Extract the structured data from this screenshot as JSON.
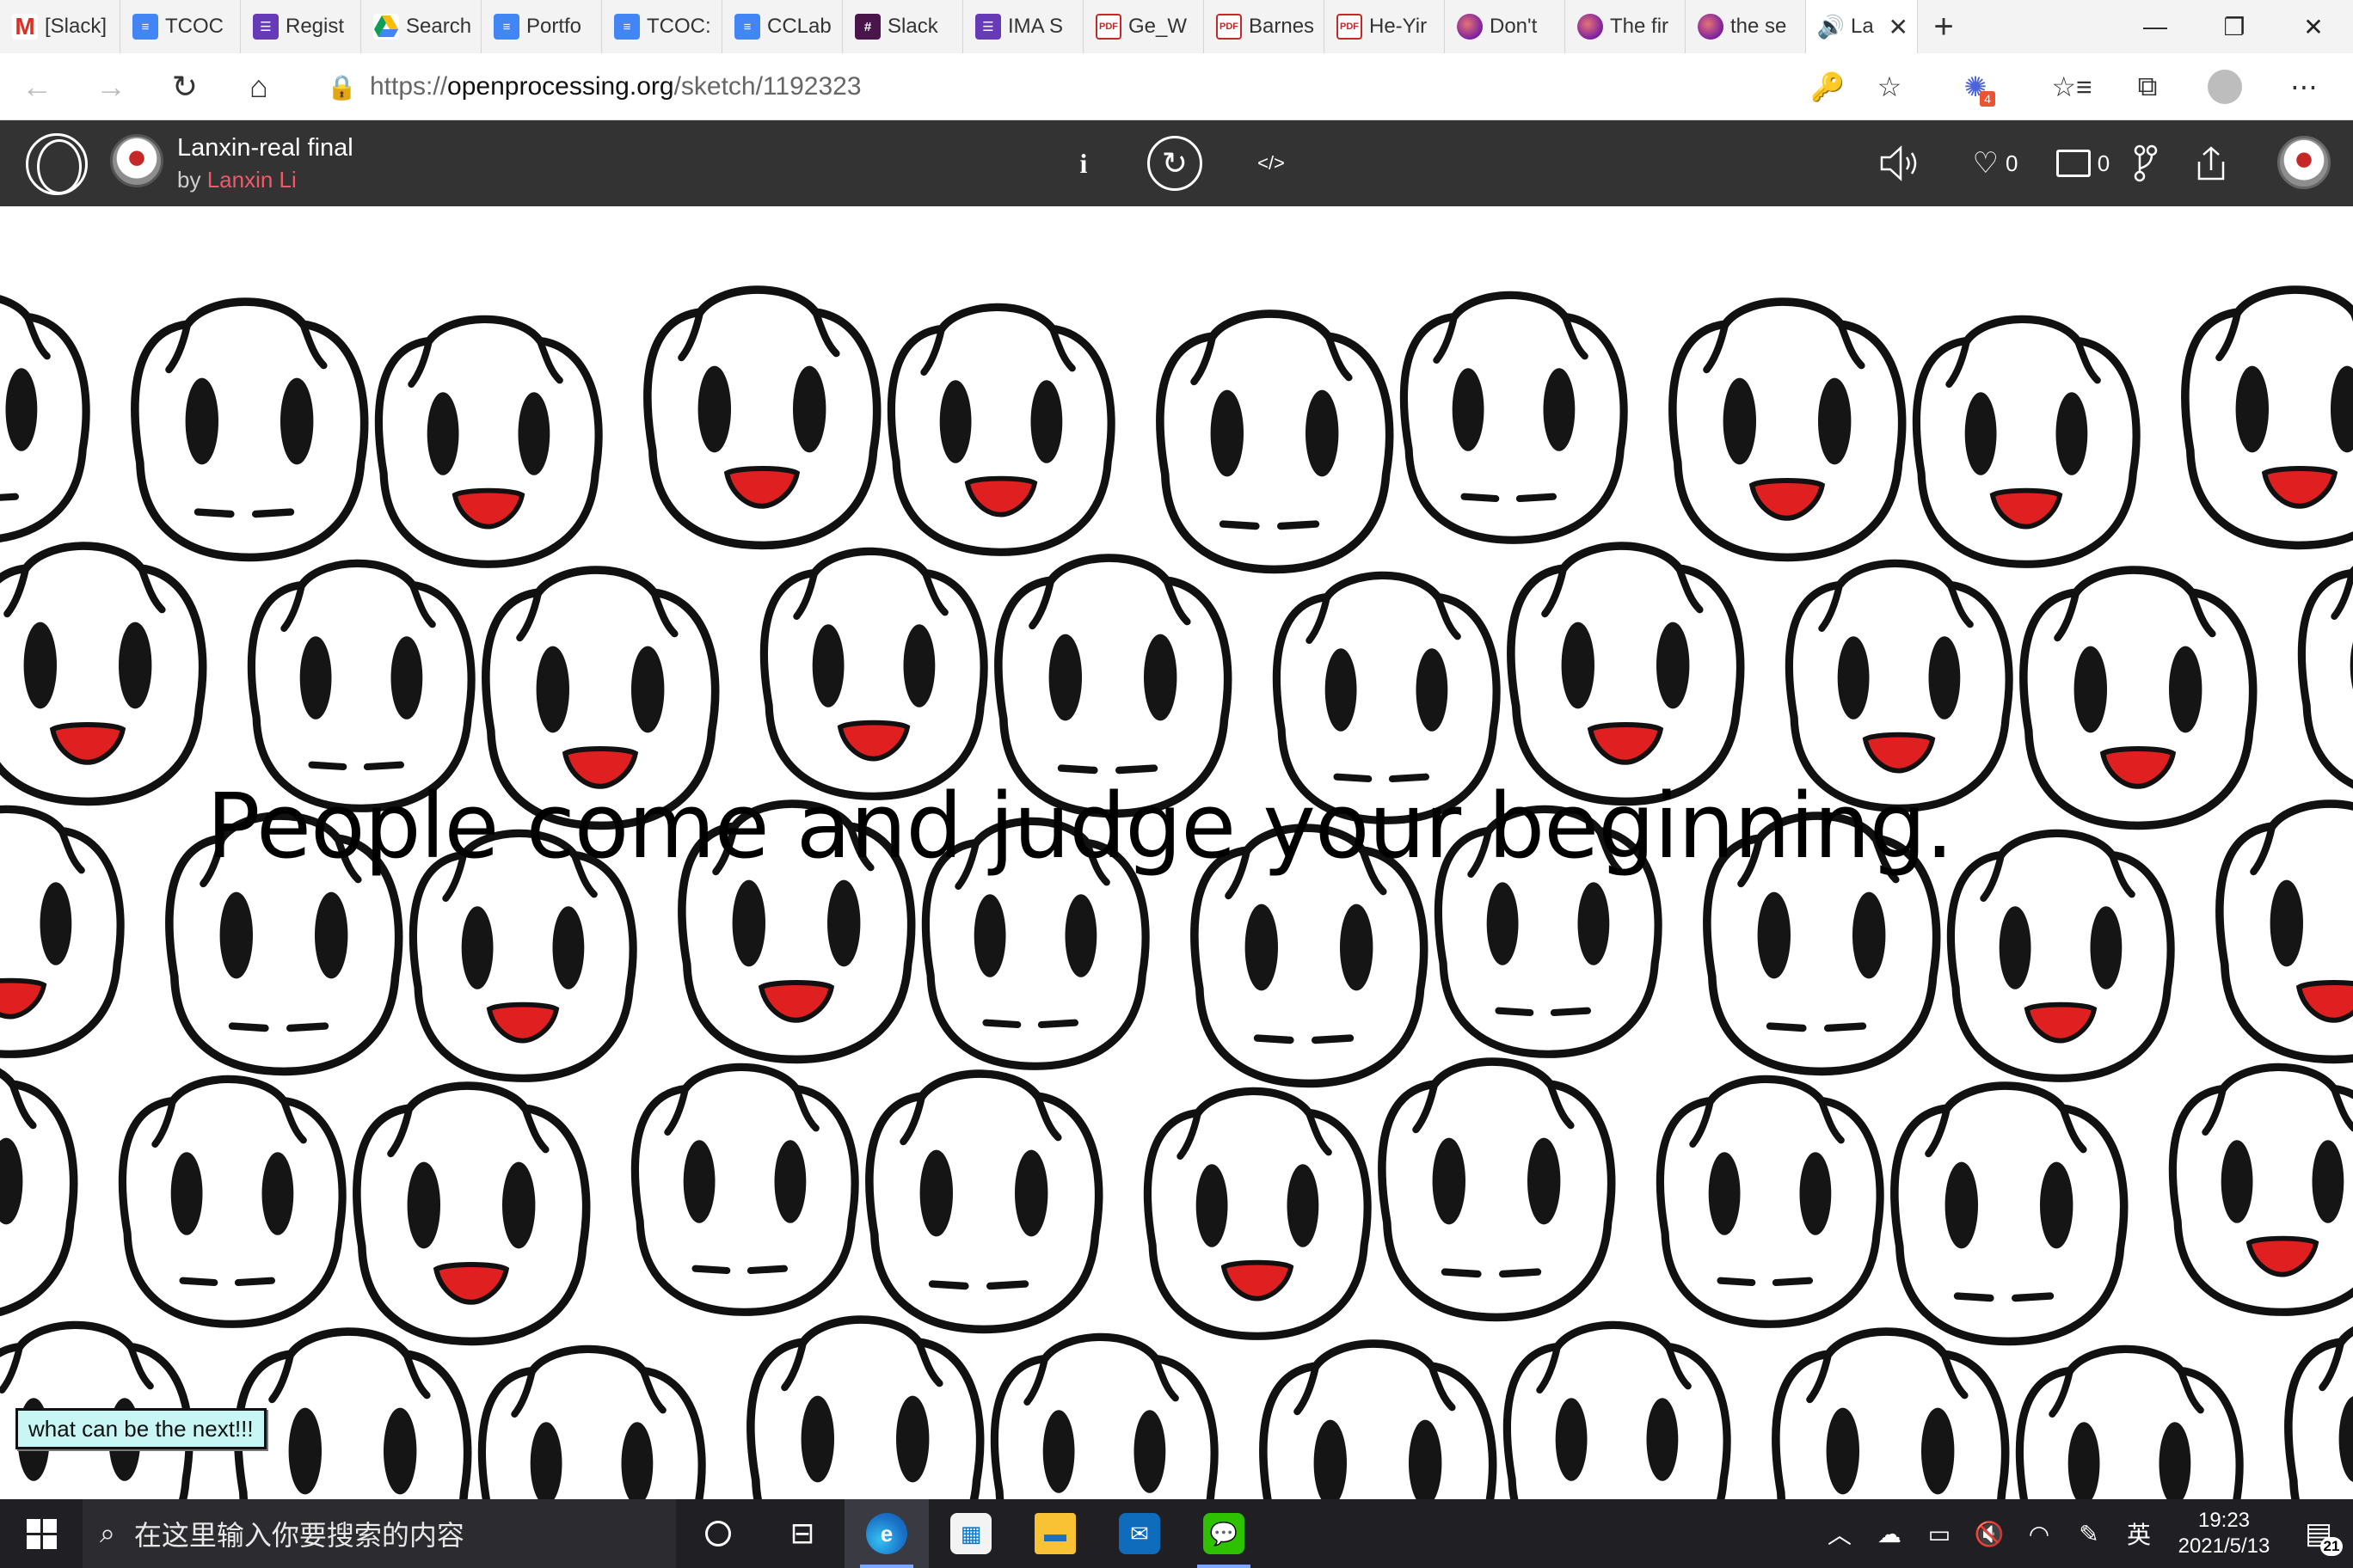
{
  "browser": {
    "tabs": [
      {
        "label": "[Slack]",
        "favicon": "gmail"
      },
      {
        "label": "TCOC",
        "favicon": "docs"
      },
      {
        "label": "Regist",
        "favicon": "forms"
      },
      {
        "label": "Search",
        "favicon": "drive"
      },
      {
        "label": "Portfo",
        "favicon": "docs"
      },
      {
        "label": "TCOC:",
        "favicon": "docs"
      },
      {
        "label": "CCLab",
        "favicon": "docs"
      },
      {
        "label": "Slack",
        "favicon": "slack"
      },
      {
        "label": "IMA S",
        "favicon": "forms"
      },
      {
        "label": "Ge_W",
        "favicon": "pdf"
      },
      {
        "label": "Barnes",
        "favicon": "pdf"
      },
      {
        "label": "He-Yir",
        "favicon": "pdf"
      },
      {
        "label": "Don't",
        "favicon": "openprocessing"
      },
      {
        "label": "The fir",
        "favicon": "openprocessing"
      },
      {
        "label": "the se",
        "favicon": "openprocessing"
      },
      {
        "label": "La",
        "favicon": "speaker",
        "active": true
      }
    ],
    "url_prefix": "https://",
    "url_host": "openprocessing.org",
    "url_path": "/sketch/1192323",
    "extension_badge": "4"
  },
  "sketch": {
    "title": "Lanxin-real final",
    "by": "by",
    "author": "Lanxin Li",
    "likes": "0",
    "comments": "0"
  },
  "canvas": {
    "caption": "People come and judge your beginning.",
    "button_label": "what can be the next!!!",
    "colors": {
      "nose": "#e02020",
      "outline": "#111111",
      "eyes": "#151515"
    }
  },
  "taskbar": {
    "search_placeholder": "在这里输入你要搜索的内容",
    "time": "19:23",
    "date": "2021/5/13",
    "ime": "英",
    "notifications": "21"
  }
}
